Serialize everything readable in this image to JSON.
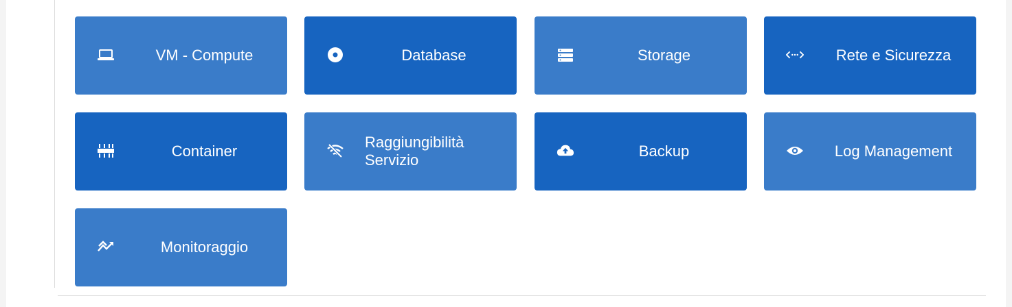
{
  "tiles": [
    {
      "label": "VM - Compute",
      "icon": "laptop-icon"
    },
    {
      "label": "Database",
      "icon": "disc-icon"
    },
    {
      "label": "Storage",
      "icon": "server-icon"
    },
    {
      "label": "Rete e Sicurezza",
      "icon": "network-arrows-icon"
    },
    {
      "label": "Container",
      "icon": "container-pods-icon"
    },
    {
      "label": "Raggiungibilità Servizio",
      "icon": "wifi-off-icon"
    },
    {
      "label": "Backup",
      "icon": "cloud-upload-icon"
    },
    {
      "label": "Log Management",
      "icon": "eye-icon"
    },
    {
      "label": "Monitoraggio",
      "icon": "trend-chart-icon"
    }
  ],
  "colors": {
    "tile_light": "#3a7cc9",
    "tile_dark": "#1764c0",
    "text": "#ffffff"
  }
}
